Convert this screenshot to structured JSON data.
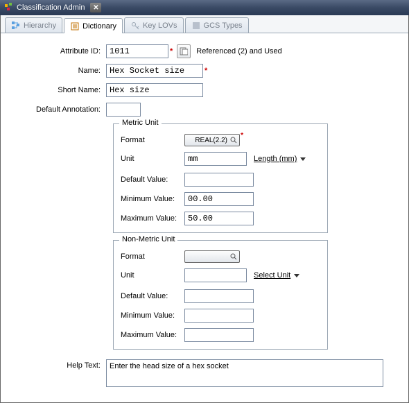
{
  "window": {
    "title": "Classification Admin"
  },
  "tabs": [
    {
      "label": "Hierarchy"
    },
    {
      "label": "Dictionary"
    },
    {
      "label": "Key LOVs"
    },
    {
      "label": "GCS Types"
    }
  ],
  "fields": {
    "attribute_id": {
      "label": "Attribute ID:",
      "value": "1011"
    },
    "referenced_note": "Referenced (2) and Used",
    "name": {
      "label": "Name:",
      "value": "Hex Socket size"
    },
    "short_name": {
      "label": "Short Name:",
      "value": "Hex size"
    },
    "default_annotation": {
      "label": "Default Annotation:",
      "value": ""
    }
  },
  "metric": {
    "title": "Metric Unit",
    "format_label": "Format",
    "format_value": "REAL(2.2)",
    "unit_label": "Unit",
    "unit_value": "mm",
    "unit_link": "Length (mm)",
    "default_label": "Default Value:",
    "default_value": "",
    "min_label": "Minimum Value:",
    "min_value": "00.00",
    "max_label": "Maximum Value:",
    "max_value": "50.00"
  },
  "nonmetric": {
    "title": "Non-Metric Unit",
    "format_label": "Format",
    "format_value": "",
    "unit_label": "Unit",
    "unit_value": "",
    "unit_link": "Select Unit",
    "default_label": "Default Value:",
    "default_value": "",
    "min_label": "Minimum Value:",
    "min_value": "",
    "max_label": "Maximum Value:",
    "max_value": ""
  },
  "help": {
    "label": "Help Text:",
    "value": "Enter the head size of a hex socket"
  }
}
